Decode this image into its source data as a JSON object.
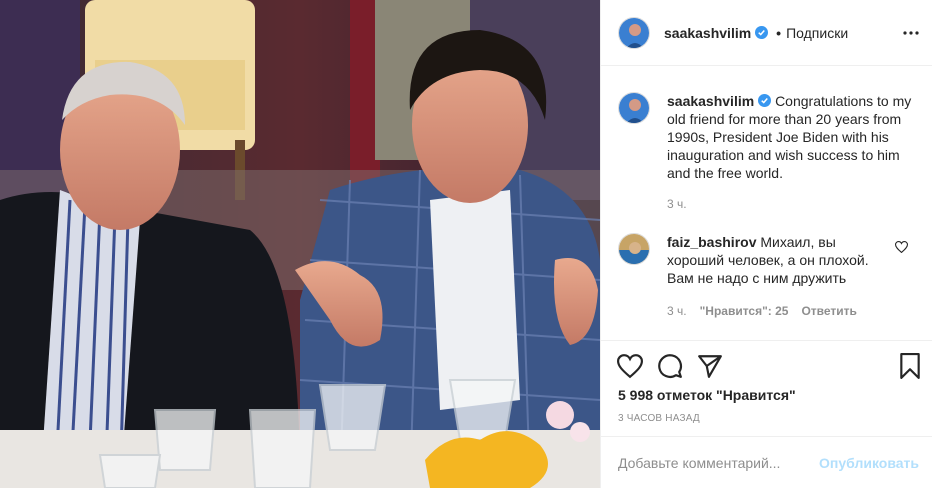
{
  "post": {
    "username": "saakashvilim",
    "follow_status": "Подписки",
    "photo_alt": "Photo"
  },
  "caption": {
    "username": "saakashvilim",
    "text": "Congratulations to my old friend for more than 20 years from 1990s, President Joe Biden with his inauguration and wish success to him and the free world.",
    "time": "3 ч."
  },
  "comment": {
    "username": "faiz_bashirov",
    "text": "Михаил, вы хороший человек, а он плохой. Вам не надо с ним дружить",
    "time": "3 ч.",
    "likes": "\"Нравится\": 25",
    "reply": "Ответить"
  },
  "stats": {
    "likes": "5 998 отметок \"Нравится\"",
    "ago": "3 ЧАСОВ НАЗАД"
  },
  "add_comment": {
    "placeholder": "Добавьте комментарий...",
    "publish": "Опубликовать"
  },
  "icons": {
    "more": "more-options-icon",
    "like": "heart-icon",
    "comment": "comment-icon",
    "share": "paper-plane-icon",
    "save": "bookmark-icon",
    "verified": "verified-badge-icon"
  },
  "colors": {
    "verified": "#3897f0",
    "publish_disabled": "#b2dffc",
    "secondary_text": "#8e8e8e"
  }
}
